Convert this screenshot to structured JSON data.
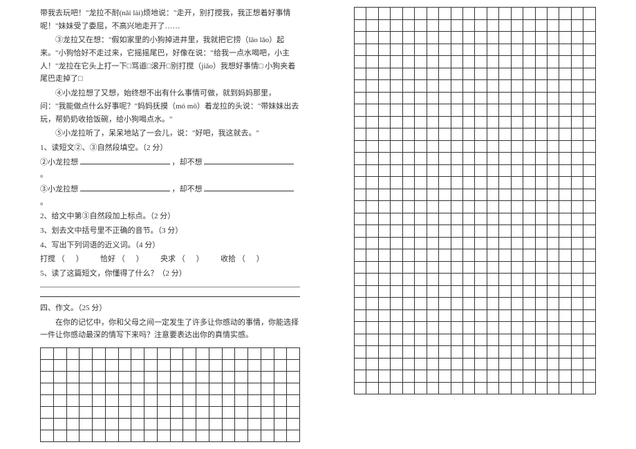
{
  "passage": {
    "p1": "带我去玩吧！\"龙拉不耐(nǎi  lài)烦地说：\"走开，别打搅我，我正想着好事情呢！\"妹妹受了委屈，不高兴地走开了……",
    "p2": "③龙拉又在想：\"假如家里的小狗掉进井里，我就把它捞（lāo  lǎo）起来。\"小狗恰好不走过来，它摇摇尾巴，好像在说：\"给我一点水喝吧，小主人！\"龙拉在它头上打一下□骂道□滚开□别打搅（jiǎo）我想好事情□ 小狗夹着尾巴走掉了□",
    "p3": "④小龙拉想了又想，始终想不出有什么事情可做，就到妈妈那里，问：\"我能做点什么好事呢？\"妈妈抚摸（mó  mō）着龙拉的头说：\"带妹妹出去玩，帮奶奶收拾饭碗，给小狗喝点水。\"",
    "p4": "⑤小龙拉听了，呆呆地站了一会儿，说：\"好吧，我这就去。\""
  },
  "questions": {
    "q1": "1、读短文②、③自然段填空。（2 分）",
    "q1a_prefix": "②小龙拉想",
    "q1a_mid": "，却不想",
    "q1a_end": "。",
    "q1b_prefix": "③小龙拉想",
    "q1b_mid": "，却不想",
    "q1b_end": "。",
    "q2": "2、给文中第③自然段加上标点。（2 分）",
    "q3": "3、划去文中括号里不正确的音节。（3 分）",
    "q4": "4、写出下列词语的近义词。（4 分）",
    "q4_w1": "打搅",
    "q4_w2": "恰好",
    "q4_w3": "央求",
    "q4_w4": "收拾",
    "q5": "5、读了这篇短文，你懂得了什么？（2 分）"
  },
  "composition": {
    "title": "四、作文。（25 分）",
    "prompt": "在你的记忆中，你和父母之间一定发生了许多让你感动的事情，你能选择一件让你感动最深的情写下来吗？注意要表达出你的真情实感。"
  },
  "grid": {
    "left_cols": 20,
    "left_rows": 8,
    "right_cols": 20,
    "right_rows": 32
  }
}
